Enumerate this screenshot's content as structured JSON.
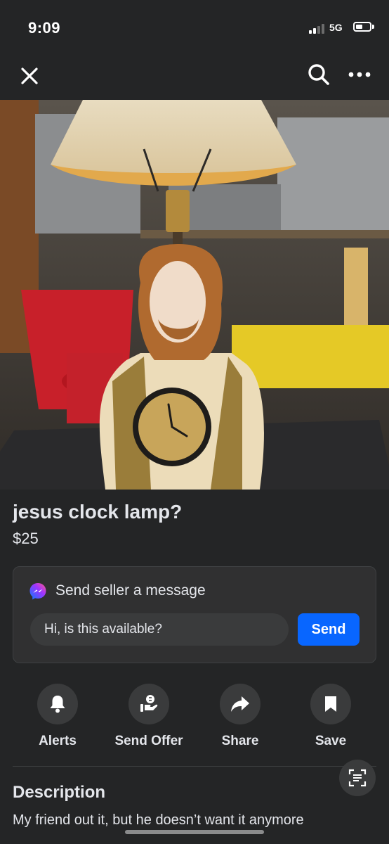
{
  "status_bar": {
    "time": "9:09",
    "network": "5G"
  },
  "nav": {
    "close_icon": "close-icon",
    "search_icon": "search-icon",
    "more_icon": "more-horizontal-icon"
  },
  "listing": {
    "title": "jesus clock lamp?",
    "price": "$25",
    "photo_pager": {
      "count": 2,
      "active_index": 0
    }
  },
  "message": {
    "heading": "Send seller a message",
    "input_value": "Hi, is this available?",
    "send_label": "Send",
    "icon": "messenger-icon",
    "accent_color": "#0866ff"
  },
  "actions": [
    {
      "label": "Alerts",
      "icon": "bell-icon"
    },
    {
      "label": "Send Offer",
      "icon": "offer-icon"
    },
    {
      "label": "Share",
      "icon": "share-arrow-icon"
    },
    {
      "label": "Save",
      "icon": "bookmark-icon"
    }
  ],
  "description": {
    "heading": "Description",
    "text": "My friend out it, but he doesn’t want it anymore"
  },
  "colors": {
    "background": "#242526",
    "card": "#303031",
    "text": "#e4e6eb",
    "button": "#0866ff"
  }
}
